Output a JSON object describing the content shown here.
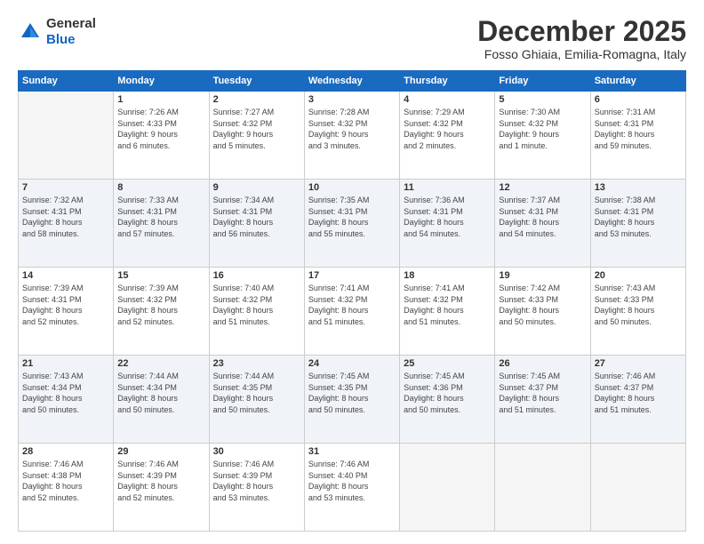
{
  "logo": {
    "general": "General",
    "blue": "Blue"
  },
  "header": {
    "month": "December 2025",
    "location": "Fosso Ghiaia, Emilia-Romagna, Italy"
  },
  "days_of_week": [
    "Sunday",
    "Monday",
    "Tuesday",
    "Wednesday",
    "Thursday",
    "Friday",
    "Saturday"
  ],
  "weeks": [
    [
      {
        "num": "",
        "info": ""
      },
      {
        "num": "1",
        "info": "Sunrise: 7:26 AM\nSunset: 4:33 PM\nDaylight: 9 hours\nand 6 minutes."
      },
      {
        "num": "2",
        "info": "Sunrise: 7:27 AM\nSunset: 4:32 PM\nDaylight: 9 hours\nand 5 minutes."
      },
      {
        "num": "3",
        "info": "Sunrise: 7:28 AM\nSunset: 4:32 PM\nDaylight: 9 hours\nand 3 minutes."
      },
      {
        "num": "4",
        "info": "Sunrise: 7:29 AM\nSunset: 4:32 PM\nDaylight: 9 hours\nand 2 minutes."
      },
      {
        "num": "5",
        "info": "Sunrise: 7:30 AM\nSunset: 4:32 PM\nDaylight: 9 hours\nand 1 minute."
      },
      {
        "num": "6",
        "info": "Sunrise: 7:31 AM\nSunset: 4:31 PM\nDaylight: 8 hours\nand 59 minutes."
      }
    ],
    [
      {
        "num": "7",
        "info": "Sunrise: 7:32 AM\nSunset: 4:31 PM\nDaylight: 8 hours\nand 58 minutes."
      },
      {
        "num": "8",
        "info": "Sunrise: 7:33 AM\nSunset: 4:31 PM\nDaylight: 8 hours\nand 57 minutes."
      },
      {
        "num": "9",
        "info": "Sunrise: 7:34 AM\nSunset: 4:31 PM\nDaylight: 8 hours\nand 56 minutes."
      },
      {
        "num": "10",
        "info": "Sunrise: 7:35 AM\nSunset: 4:31 PM\nDaylight: 8 hours\nand 55 minutes."
      },
      {
        "num": "11",
        "info": "Sunrise: 7:36 AM\nSunset: 4:31 PM\nDaylight: 8 hours\nand 54 minutes."
      },
      {
        "num": "12",
        "info": "Sunrise: 7:37 AM\nSunset: 4:31 PM\nDaylight: 8 hours\nand 54 minutes."
      },
      {
        "num": "13",
        "info": "Sunrise: 7:38 AM\nSunset: 4:31 PM\nDaylight: 8 hours\nand 53 minutes."
      }
    ],
    [
      {
        "num": "14",
        "info": "Sunrise: 7:39 AM\nSunset: 4:31 PM\nDaylight: 8 hours\nand 52 minutes."
      },
      {
        "num": "15",
        "info": "Sunrise: 7:39 AM\nSunset: 4:32 PM\nDaylight: 8 hours\nand 52 minutes."
      },
      {
        "num": "16",
        "info": "Sunrise: 7:40 AM\nSunset: 4:32 PM\nDaylight: 8 hours\nand 51 minutes."
      },
      {
        "num": "17",
        "info": "Sunrise: 7:41 AM\nSunset: 4:32 PM\nDaylight: 8 hours\nand 51 minutes."
      },
      {
        "num": "18",
        "info": "Sunrise: 7:41 AM\nSunset: 4:32 PM\nDaylight: 8 hours\nand 51 minutes."
      },
      {
        "num": "19",
        "info": "Sunrise: 7:42 AM\nSunset: 4:33 PM\nDaylight: 8 hours\nand 50 minutes."
      },
      {
        "num": "20",
        "info": "Sunrise: 7:43 AM\nSunset: 4:33 PM\nDaylight: 8 hours\nand 50 minutes."
      }
    ],
    [
      {
        "num": "21",
        "info": "Sunrise: 7:43 AM\nSunset: 4:34 PM\nDaylight: 8 hours\nand 50 minutes."
      },
      {
        "num": "22",
        "info": "Sunrise: 7:44 AM\nSunset: 4:34 PM\nDaylight: 8 hours\nand 50 minutes."
      },
      {
        "num": "23",
        "info": "Sunrise: 7:44 AM\nSunset: 4:35 PM\nDaylight: 8 hours\nand 50 minutes."
      },
      {
        "num": "24",
        "info": "Sunrise: 7:45 AM\nSunset: 4:35 PM\nDaylight: 8 hours\nand 50 minutes."
      },
      {
        "num": "25",
        "info": "Sunrise: 7:45 AM\nSunset: 4:36 PM\nDaylight: 8 hours\nand 50 minutes."
      },
      {
        "num": "26",
        "info": "Sunrise: 7:45 AM\nSunset: 4:37 PM\nDaylight: 8 hours\nand 51 minutes."
      },
      {
        "num": "27",
        "info": "Sunrise: 7:46 AM\nSunset: 4:37 PM\nDaylight: 8 hours\nand 51 minutes."
      }
    ],
    [
      {
        "num": "28",
        "info": "Sunrise: 7:46 AM\nSunset: 4:38 PM\nDaylight: 8 hours\nand 52 minutes."
      },
      {
        "num": "29",
        "info": "Sunrise: 7:46 AM\nSunset: 4:39 PM\nDaylight: 8 hours\nand 52 minutes."
      },
      {
        "num": "30",
        "info": "Sunrise: 7:46 AM\nSunset: 4:39 PM\nDaylight: 8 hours\nand 53 minutes."
      },
      {
        "num": "31",
        "info": "Sunrise: 7:46 AM\nSunset: 4:40 PM\nDaylight: 8 hours\nand 53 minutes."
      },
      {
        "num": "",
        "info": ""
      },
      {
        "num": "",
        "info": ""
      },
      {
        "num": "",
        "info": ""
      }
    ]
  ]
}
